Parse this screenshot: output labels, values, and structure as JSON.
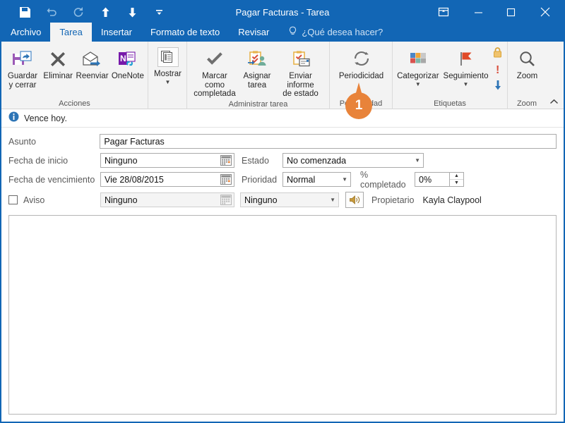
{
  "window": {
    "title": "Pagar Facturas - Tarea",
    "accent_color": "#1266B5",
    "ribbon_bg": "#f3f3f3"
  },
  "quick_access": {
    "items": [
      {
        "name": "save-icon",
        "label": "Guardar",
        "dim": false
      },
      {
        "name": "undo-icon",
        "label": "Deshacer",
        "dim": true
      },
      {
        "name": "redo-icon",
        "label": "Rehacer",
        "dim": true
      },
      {
        "name": "previous-item-icon",
        "label": "Elemento anterior",
        "dim": false
      },
      {
        "name": "next-item-icon",
        "label": "Elemento siguiente",
        "dim": false
      },
      {
        "name": "customize-qat-icon",
        "label": "Personalizar barra de herramientas de acceso rápido",
        "dim": false
      }
    ]
  },
  "window_controls": {
    "ribbon_display_label": "Opciones de presentación de la cinta",
    "minimize_label": "Minimizar",
    "maximize_label": "Maximizar",
    "close_label": "Cerrar"
  },
  "tabs": [
    {
      "label": "Archivo",
      "active": false
    },
    {
      "label": "Tarea",
      "active": true
    },
    {
      "label": "Insertar",
      "active": false
    },
    {
      "label": "Formato de texto",
      "active": false
    },
    {
      "label": "Revisar",
      "active": false
    }
  ],
  "tell_me": {
    "icon": "lightbulb-icon",
    "label": "¿Qué desea hacer?"
  },
  "ribbon": {
    "groups": [
      {
        "name": "acciones",
        "label": "Acciones",
        "buttons": [
          {
            "name": "guardar-y-cerrar",
            "label": "Guardar\ny cerrar",
            "icon": "save-close-icon",
            "caret": false
          },
          {
            "name": "eliminar",
            "label": "Eliminar",
            "icon": "delete-x-icon",
            "caret": false
          },
          {
            "name": "reenviar",
            "label": "Reenviar",
            "icon": "forward-envelope-icon",
            "caret": false
          },
          {
            "name": "onenote",
            "label": "OneNote",
            "icon": "onenote-icon",
            "caret": false
          }
        ]
      },
      {
        "name": "mostrar",
        "label": "",
        "buttons": [
          {
            "name": "mostrar",
            "label": "Mostrar",
            "icon": "show-pages-icon",
            "caret": true
          }
        ]
      },
      {
        "name": "administrar-tarea",
        "label": "Administrar tarea",
        "buttons": [
          {
            "name": "marcar-como-completada",
            "label": "Marcar como\ncompletada",
            "icon": "checkmark-icon",
            "caret": false
          },
          {
            "name": "asignar-tarea",
            "label": "Asignar\ntarea",
            "icon": "assign-task-icon",
            "caret": false
          },
          {
            "name": "enviar-informe-de-estado",
            "label": "Enviar informe\nde estado",
            "icon": "status-report-icon",
            "caret": false
          }
        ]
      },
      {
        "name": "periodicidad",
        "label": "Periodicidad",
        "buttons": [
          {
            "name": "periodicidad",
            "label": "Periodicidad",
            "icon": "recurrence-icon",
            "caret": false
          }
        ]
      },
      {
        "name": "etiquetas",
        "label": "Etiquetas",
        "buttons": [
          {
            "name": "categorizar",
            "label": "Categorizar",
            "icon": "categorize-icon",
            "caret": true
          },
          {
            "name": "seguimiento",
            "label": "Seguimiento",
            "icon": "flag-followup-icon",
            "caret": true
          }
        ],
        "mini_buttons": [
          {
            "name": "private-lock-icon",
            "label": "Privado"
          },
          {
            "name": "high-importance-icon",
            "label": "Importancia alta"
          },
          {
            "name": "low-importance-icon",
            "label": "Importancia baja"
          }
        ]
      },
      {
        "name": "zoom",
        "label": "Zoom",
        "buttons": [
          {
            "name": "zoom",
            "label": "Zoom",
            "icon": "magnifier-icon",
            "caret": false
          }
        ]
      }
    ],
    "collapse_label": "Contraer la cinta de opciones"
  },
  "badge": {
    "number": "1",
    "color": "#e8833a"
  },
  "info_bar": {
    "icon": "info-icon",
    "text": "Vence hoy."
  },
  "form": {
    "subject": {
      "label": "Asunto",
      "value": "Pagar Facturas"
    },
    "start_date": {
      "label": "Fecha de inicio",
      "value": "Ninguno"
    },
    "due_date": {
      "label": "Fecha de vencimiento",
      "value": "Vie 28/08/2015"
    },
    "reminder": {
      "label": "Aviso",
      "checked": false,
      "date_value": "Ninguno",
      "time_value": "Ninguno"
    },
    "status": {
      "label": "Estado",
      "value": "No comenzada"
    },
    "priority": {
      "label": "Prioridad",
      "value": "Normal"
    },
    "percent_complete": {
      "label": "% completado",
      "value": "0%"
    },
    "owner": {
      "label": "Propietario",
      "value": "Kayla Claypool"
    },
    "sound_button": {
      "name": "reminder-sound-icon",
      "label": "Sonido de aviso"
    }
  },
  "body": {
    "value": ""
  }
}
